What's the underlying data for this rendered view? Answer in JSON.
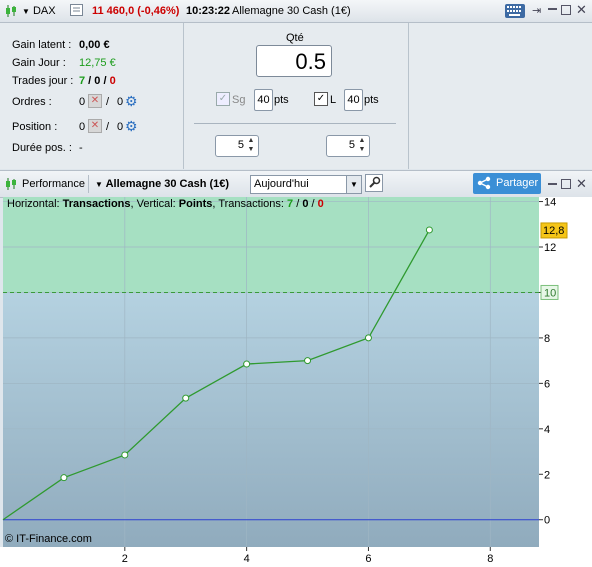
{
  "titlebar": {
    "instrument": "DAX",
    "price_change": "11 460,0 (-0,46%)",
    "time": "10:23:22",
    "market": "Allemagne 30 Cash (1€)"
  },
  "stats": {
    "gain_latent_label": "Gain latent :",
    "gain_latent_value": "0,00 €",
    "gain_jour_label": "Gain Jour :",
    "gain_jour_value": "12,75 €",
    "trades_label": "Trades jour :",
    "trades_win": "7",
    "trades_sep1": " / ",
    "trades_neutral": "0",
    "trades_sep2": " / ",
    "trades_loss": "0",
    "ordres_label": "Ordres :",
    "ordres_a": "0",
    "ordres_sep": "/ ",
    "ordres_b": "0",
    "position_label": "Position :",
    "position_a": "0",
    "position_sep": "/ ",
    "position_b": "0",
    "duree_label": "Durée pos. :",
    "duree_value": "-"
  },
  "order": {
    "qty_label": "Qté",
    "qty_value": "0.5",
    "sg_label": "Sg",
    "sg_value": "40",
    "sg_unit": "pts",
    "l_label": "L",
    "l_value": "40",
    "l_unit": "pts",
    "spin_left": "5",
    "spin_right": "5"
  },
  "perf_toolbar": {
    "performance_label": "Performance",
    "market_label": "Allemagne 30 Cash (1€)",
    "period_value": "Aujourd'hui",
    "share_label": "Partager"
  },
  "chart_header": {
    "h_prefix": "Horizontal: ",
    "h_value": "Transactions",
    "v_prefix": ", Vertical: ",
    "v_value": "Points",
    "t_prefix": ", Transactions: ",
    "t_win": "7",
    "t_sep1": " / ",
    "t_neutral": "0",
    "t_sep2": " / ",
    "t_loss": "0"
  },
  "copyright": "© IT-Finance.com",
  "chart_data": {
    "type": "line",
    "x": [
      0,
      1,
      2,
      3,
      4,
      5,
      6,
      7
    ],
    "y": [
      0,
      1.85,
      2.85,
      5.35,
      6.85,
      7.0,
      8.0,
      12.75
    ],
    "xlim": [
      0,
      8.8
    ],
    "ylim": [
      -1.2,
      14.2
    ],
    "x_ticks": [
      2,
      4,
      6,
      8
    ],
    "y_ticks": [
      0,
      2,
      4,
      6,
      8,
      10,
      12,
      14
    ],
    "target_level": 10,
    "target_label": "10",
    "current_label": "12,8",
    "grid": true,
    "line_color": "#2f9a2f",
    "zero_line_color": "#2a3fd1",
    "profit_zone_color": "#a6e0c2"
  }
}
